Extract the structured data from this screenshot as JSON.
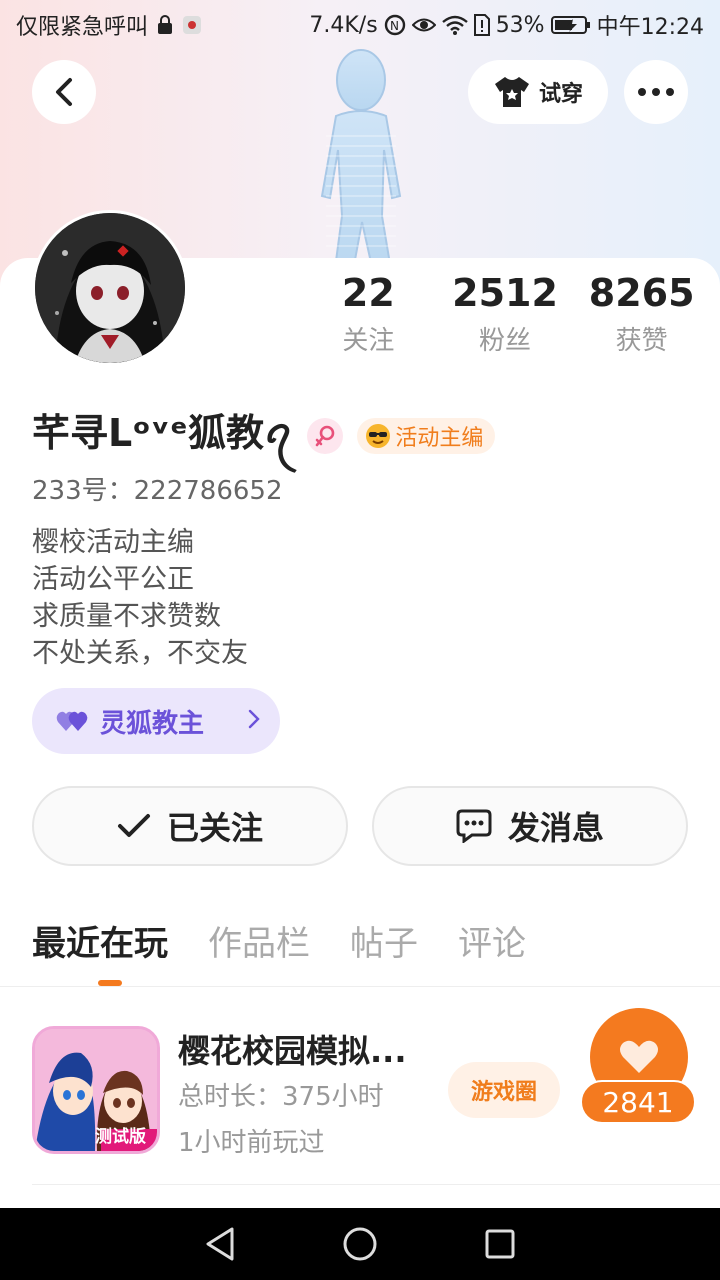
{
  "status_bar": {
    "carrier_text": "仅限紧急呼叫",
    "net_speed": "7.4K/s",
    "battery_percent": "53%",
    "time": "中午12:24"
  },
  "header": {
    "back_icon": "chevron-left-icon",
    "tryon_label": "试穿",
    "more_icon": "ellipsis-icon"
  },
  "profile": {
    "stats": [
      {
        "value": "22",
        "label": "关注"
      },
      {
        "value": "2512",
        "label": "粉丝"
      },
      {
        "value": "8265",
        "label": "获赞"
      }
    ],
    "nickname": "芊寻Lᵒᵛᵉ狐教ꪖ",
    "gender": "female",
    "role_badge": "活动主编",
    "uid": "233号：222786652",
    "bio_lines": [
      "樱校活动主编",
      "活动公平公正",
      "求质量不求赞数",
      "不处关系，不交友"
    ],
    "fan_tag": "灵狐教主"
  },
  "actions": {
    "follow_label": "已关注",
    "message_label": "发消息"
  },
  "tabs": [
    {
      "label": "最近在玩",
      "active": true
    },
    {
      "label": "作品栏",
      "active": false
    },
    {
      "label": "帖子",
      "active": false
    },
    {
      "label": "评论",
      "active": false
    }
  ],
  "recent_games": [
    {
      "title": "樱花校园模拟...",
      "duration": "总时长：375小时",
      "last_played": "1小时前玩过",
      "circle_label": "游戏圈",
      "likes": "2841",
      "icon_caption": "测试版"
    }
  ],
  "colors": {
    "accent": "#f47a1f",
    "fan_tag": "#6b52d9"
  }
}
